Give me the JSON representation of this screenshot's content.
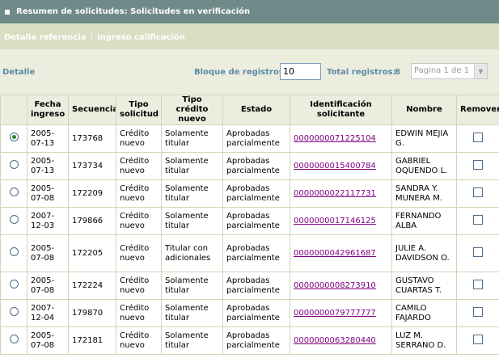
{
  "header": {
    "title": "Resumen de solicitudes: Solicitudes en verificación"
  },
  "links": [
    {
      "label": "Detalle referencia"
    },
    {
      "label": "Ingreso calificación"
    }
  ],
  "controls": {
    "detalle_label": "Detalle",
    "bloque_label": "Bloque de registros:",
    "bloque_value": "10",
    "total_label": "Total registros:",
    "total_value": "8",
    "pager_text": "Pagina 1 de 1"
  },
  "table": {
    "columns": [
      "",
      "Fecha ingreso",
      "Secuencia",
      "Tipo solicitud",
      "Tipo crédito nuevo",
      "Estado",
      "Identificación solicitante",
      "Nombre",
      "Remover"
    ],
    "rows": [
      {
        "selected": true,
        "fecha": "2005-07-13",
        "secuencia": "173768",
        "tipo_solicitud": "Crédito nuevo",
        "tipo_credito": "Solamente titular",
        "estado": "Aprobadas parcialmente",
        "identificacion": "0000000071225104",
        "nombre": "EDWIN MEJIA G."
      },
      {
        "selected": false,
        "fecha": "2005-07-13",
        "secuencia": "173734",
        "tipo_solicitud": "Crédito nuevo",
        "tipo_credito": "Solamente titular",
        "estado": "Aprobadas parcialmente",
        "identificacion": "0000000015400784",
        "nombre": "GABRIEL OQUENDO L."
      },
      {
        "selected": false,
        "fecha": "2005-07-08",
        "secuencia": "172209",
        "tipo_solicitud": "Crédito nuevo",
        "tipo_credito": "Solamente titular",
        "estado": "Aprobadas parcialmente",
        "identificacion": "0000000022117731",
        "nombre": "SANDRA Y. MUNERA M."
      },
      {
        "selected": false,
        "fecha": "2007-12-03",
        "secuencia": "179866",
        "tipo_solicitud": "Crédito nuevo",
        "tipo_credito": "Solamente titular",
        "estado": "Aprobadas parcialmente",
        "identificacion": "0000000017146125",
        "nombre": "FERNANDO ALBA"
      },
      {
        "selected": false,
        "fecha": "2005-07-08",
        "secuencia": "172205",
        "tipo_solicitud": "Crédito nuevo",
        "tipo_credito": "Titular con adicionales",
        "estado": "Aprobadas parcialmente",
        "identificacion": "0000000042961687",
        "nombre": "JULIE A. DAVIDSON O."
      },
      {
        "selected": false,
        "fecha": "2005-07-08",
        "secuencia": "172224",
        "tipo_solicitud": "Crédito nuevo",
        "tipo_credito": "Solamente titular",
        "estado": "Aprobadas parcialmente",
        "identificacion": "0000000008273910",
        "nombre": "GUSTAVO CUARTAS T."
      },
      {
        "selected": false,
        "fecha": "2007-12-04",
        "secuencia": "179870",
        "tipo_solicitud": "Crédito nuevo",
        "tipo_credito": "Solamente titular",
        "estado": "Aprobadas parcialmente",
        "identificacion": "0000000079777777",
        "nombre": "CAMILO FAJARDO"
      },
      {
        "selected": false,
        "fecha": "2005-07-08",
        "secuencia": "172181",
        "tipo_solicitud": "Crédito nuevo",
        "tipo_credito": "Solamente titular",
        "estado": "Aprobadas parcialmente",
        "identificacion": "0000000063280440",
        "nombre": "LUZ M. SERRANO D."
      }
    ]
  }
}
